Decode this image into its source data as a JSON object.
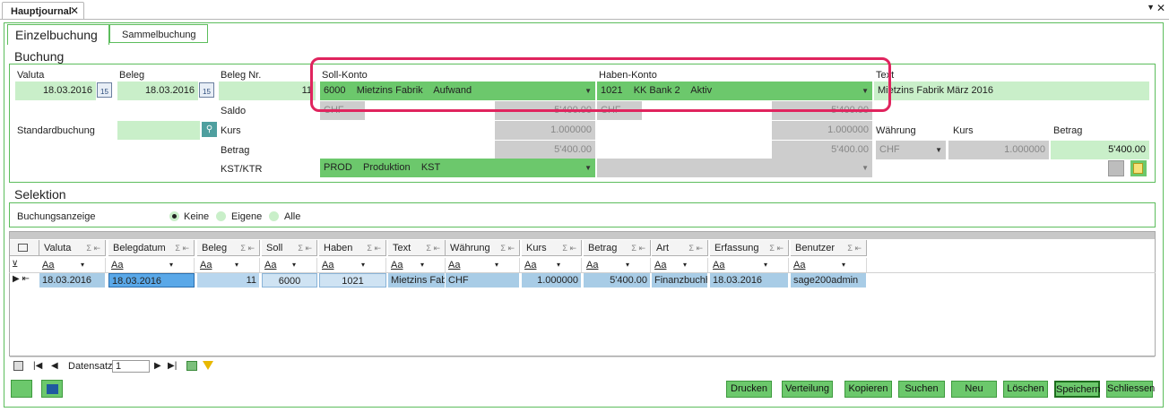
{
  "doc_tab": {
    "title": "Hauptjournal",
    "close": "✕"
  },
  "window": {
    "dropdown": "▼",
    "close": "✕"
  },
  "tabs": {
    "active": "Einzelbuchung",
    "other": "Sammelbuchung"
  },
  "buchung": {
    "title": "Buchung",
    "valuta_label": "Valuta",
    "valuta": "18.03.2016",
    "beleg_label": "Beleg",
    "beleg": "18.03.2016",
    "belegnr_label": "Beleg Nr.",
    "belegnr": "11",
    "soll_label": "Soll-Konto",
    "soll": "6000    Mietzins Fabrik    Aufwand",
    "haben_label": "Haben-Konto",
    "haben": "1021    KK Bank 2    Aktiv",
    "text_label": "Text",
    "text": "Mietzins Fabrik März 2016",
    "saldo_label": "Saldo",
    "saldo_soll_ccy": "CHF",
    "saldo_soll": "5'400.00",
    "saldo_haben_ccy": "CHF",
    "saldo_haben": "5'400.00",
    "standard_label": "Standardbuchung",
    "kurs_label": "Kurs",
    "kurs_soll": "1.000000",
    "kurs_haben": "1.000000",
    "betrag_label": "Betrag",
    "betrag_soll": "5'400.00",
    "betrag_haben": "5'400.00",
    "waehrung_label": "Währung",
    "waehrung": "CHF",
    "kurs2_label": "Kurs",
    "kurs2": "1.000000",
    "betrag2_label": "Betrag",
    "betrag2": "5'400.00",
    "kst_label": "KST/KTR",
    "kst": "PROD    Produktion    KST",
    "kst2": ""
  },
  "selektion": {
    "title": "Selektion",
    "anzeige_label": "Buchungsanzeige",
    "opt1": "Keine",
    "opt2": "Eigene",
    "opt3": "Alle",
    "selected": "Keine"
  },
  "grid": {
    "columns": [
      "Valuta",
      "Belegdatum",
      "Beleg",
      "Soll",
      "Haben",
      "Text",
      "Währung",
      "Kurs",
      "Betrag",
      "Art",
      "Erfassung",
      "Benutzer"
    ],
    "sum_icon": "Σ ⇤",
    "filter": "Aa",
    "filter_dd": "▾",
    "row": [
      "18.03.2016",
      "18.03.2016",
      "11",
      "6000",
      "1021",
      "Mietzins Fabr",
      "CHF",
      "1.000000",
      "5'400.00",
      "Finanzbuchha",
      "18.03.2016",
      "sage200admin"
    ],
    "row_marker": "▶ ⇤"
  },
  "nav": {
    "first": "|◀",
    "prev": "◀",
    "label": "Datensatz",
    "value": "1",
    "next": "▶",
    "last": "▶|"
  },
  "buttons": [
    "Drucken",
    "Verteilung",
    "Kopieren",
    "Suchen",
    "Neu",
    "Löschen",
    "Speichern",
    "Schliessen"
  ]
}
